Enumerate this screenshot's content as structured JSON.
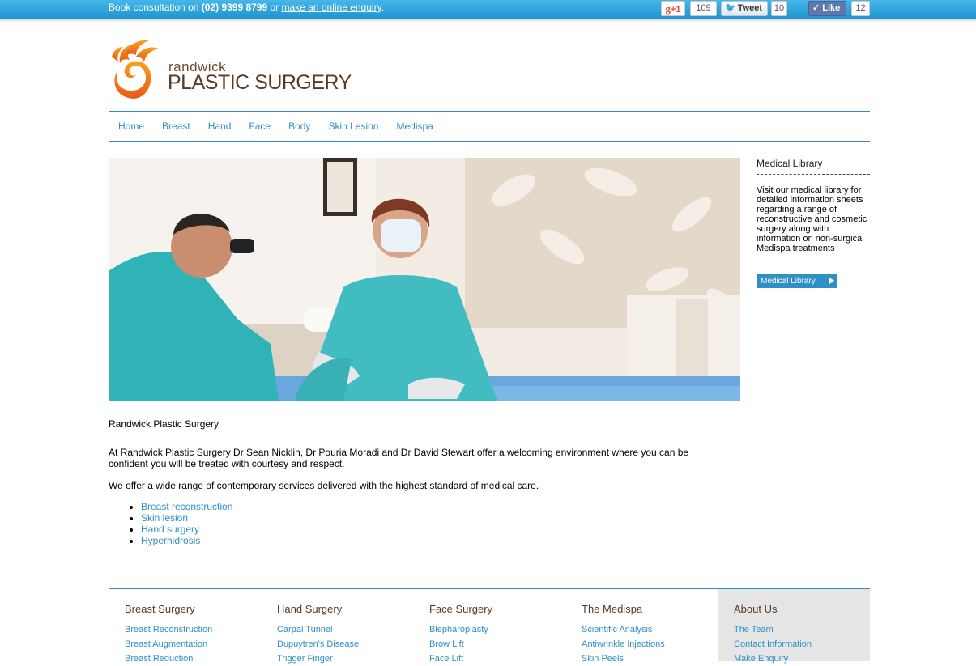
{
  "topbar": {
    "booking_prefix": "Book consultation on ",
    "phone": "(02) 9399 8799",
    "booking_or": " or ",
    "enquiry_link": "make an online enquiry",
    "booking_suffix": ".",
    "gplus_label": "+1",
    "gplus_count": "109",
    "tweet_label": "Tweet",
    "tweet_count": "10",
    "like_label": "Like",
    "like_count": "12"
  },
  "logo": {
    "line1": "randwick",
    "line2": "PLASTIC SURGERY"
  },
  "nav": {
    "items": [
      "Home",
      "Breast",
      "Hand",
      "Face",
      "Body",
      "Skin Lesion",
      "Medispa"
    ]
  },
  "sidebar": {
    "title": "Medical Library",
    "text": "Visit our medical library for detailed information sheets regarding a range of reconstructive and cosmetic surgery along with information on non-surgical Medispa treatments",
    "button": "Medical Library"
  },
  "content": {
    "title": "Randwick Plastic Surgery",
    "intro": "At Randwick Plastic Surgery Dr Sean Nicklin, Dr Pouria Moradi and Dr David Stewart offer a welcoming environment where you can be confident you will be treated with courtesy and respect.",
    "para": "We offer a wide range of contemporary services delivered with the highest standard of medical care.",
    "links": [
      "Breast reconstruction",
      "Skin lesion",
      "Hand surgery",
      "Hyperhidrosis"
    ]
  },
  "footer": {
    "columns": [
      {
        "title": "Breast Surgery",
        "links": [
          "Breast Reconstruction",
          "Breast Augmentation",
          "Breast Reduction"
        ]
      },
      {
        "title": "Hand Surgery",
        "links": [
          "Carpal Tunnel",
          "Dupuytren's Disease",
          "Trigger Finger"
        ]
      },
      {
        "title": "Face Surgery",
        "links": [
          "Blepharoplasty",
          "Brow Lift",
          "Face Lift"
        ]
      },
      {
        "title": "The Medispa",
        "links": [
          "Scientific Analysis",
          "Antiwrinkle Injections",
          "Skin Peels"
        ]
      },
      {
        "title": "About Us",
        "links": [
          "The Team",
          "Contact Information",
          "Make Enquiry"
        ]
      }
    ]
  },
  "colors": {
    "accent": "#2f8fc7",
    "topbar": "#2da3dc",
    "brand_orange": "#f07a1a",
    "brand_brown": "#5a3a22"
  }
}
